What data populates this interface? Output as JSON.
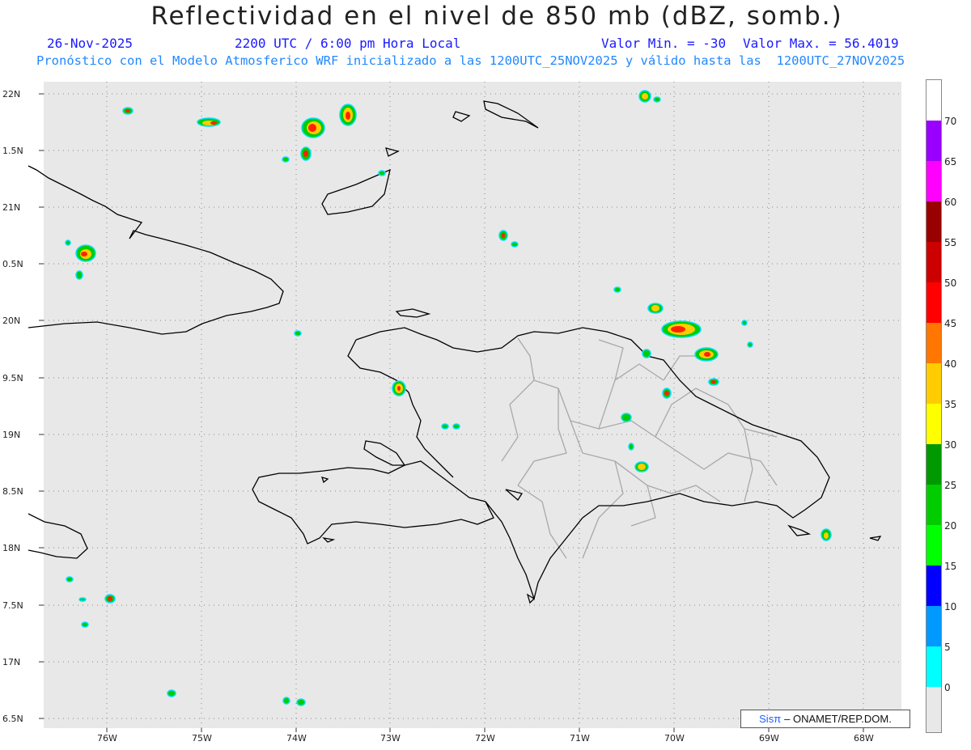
{
  "header": {
    "title": "Reflectividad en el nivel de 850 mb (dBZ, somb.)",
    "date": "26-Nov-2025",
    "time": "2200 UTC / 6:00 pm Hora Local",
    "valmin": "Valor Min. = -30",
    "valmax": "Valor Max. = 56.4019",
    "subtitle": "Pronóstico con el Modelo Atmosferico WRF inicializado a las 1200UTC_25NOV2025 y válido hasta las  1200UTC_27NOV2025"
  },
  "axes": {
    "lat_labels": [
      "22N",
      "1.5N",
      "21N",
      "0.5N",
      "20N",
      "9.5N",
      "19N",
      "8.5N",
      "18N",
      "7.5N",
      "17N",
      "6.5N"
    ],
    "lon_labels": [
      "76W",
      "75W",
      "74W",
      "73W",
      "72W",
      "71W",
      "70W",
      "69W",
      "68W"
    ]
  },
  "credit": {
    "sis": "Sisπ",
    "text": "– ONAMET/REP.DOM."
  },
  "colorbar": {
    "labels": [
      "70",
      "65",
      "60",
      "55",
      "50",
      "45",
      "40",
      "35",
      "30",
      "25",
      "20",
      "15",
      "10",
      "5",
      "0"
    ],
    "colors": [
      "#ffffff",
      "#9900ff",
      "#ff00ff",
      "#990000",
      "#cc0000",
      "#ff0000",
      "#ff7700",
      "#ffcc00",
      "#ffff00",
      "#009900",
      "#00cc00",
      "#00ff00",
      "#0000ff",
      "#0099ff",
      "#00ffff",
      "#e8e8e8"
    ]
  },
  "colors": {
    "map_bg": "#e8e8e8",
    "coast": "#000000",
    "province": "#a0a0a0",
    "grid": "#888888"
  }
}
